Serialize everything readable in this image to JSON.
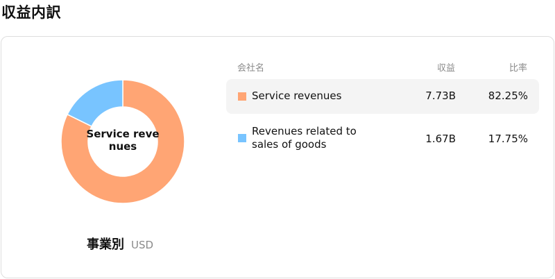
{
  "header": {
    "title": "収益内訳"
  },
  "chart": {
    "center_label": "Service revenues",
    "caption": "事業別",
    "unit": "USD"
  },
  "table": {
    "columns": {
      "company": "会社名",
      "revenue": "収益",
      "ratio": "比率"
    },
    "rows": [
      {
        "name": "Service revenues",
        "revenue": "7.73B",
        "ratio": "82.25%",
        "color": "#FFA574",
        "highlighted": true
      },
      {
        "name": "Revenues related to sales of goods",
        "revenue": "1.67B",
        "ratio": "17.75%",
        "color": "#78C4FF",
        "highlighted": false
      }
    ]
  },
  "chart_data": {
    "type": "pie",
    "categories": [
      "Service revenues",
      "Revenues related to sales of goods"
    ],
    "values": [
      82.25,
      17.75
    ],
    "colors": [
      "#FFA574",
      "#78C4FF"
    ],
    "title": "",
    "unit": "USD"
  }
}
